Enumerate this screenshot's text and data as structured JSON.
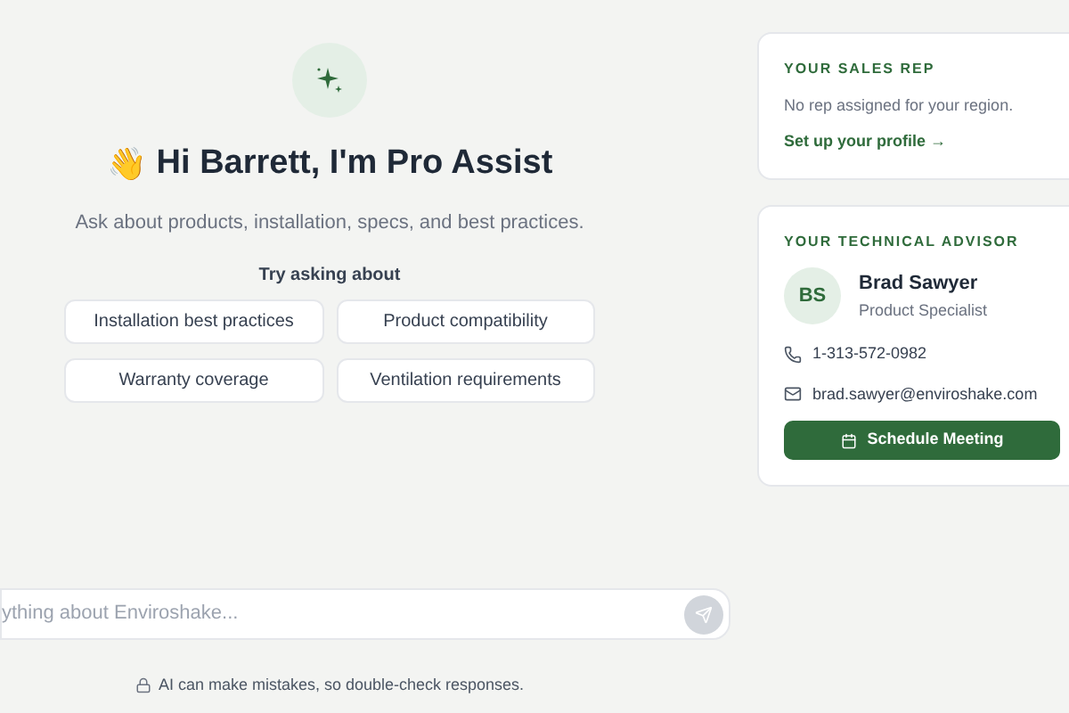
{
  "greeting": {
    "emoji": "👋",
    "title": "Hi Barrett, I'm Pro Assist",
    "subtitle": "Ask about products, installation, specs, and best practices."
  },
  "suggestions": {
    "heading": "Try asking about",
    "items": [
      "Installation best practices",
      "Product compatibility",
      "Warranty coverage",
      "Ventilation requirements"
    ]
  },
  "composer": {
    "placeholder": "ything about Enviroshake...",
    "disclaimer": "AI can make mistakes, so double-check responses."
  },
  "sales_rep": {
    "heading": "YOUR SALES REP",
    "message": "No rep assigned for your region.",
    "link": "Set up your profile →"
  },
  "advisor": {
    "heading": "YOUR TECHNICAL ADVISOR",
    "initials": "BS",
    "name": "Brad Sawyer",
    "role": "Product Specialist",
    "phone": "1-313-572-0982",
    "email": "brad.sawyer@enviroshake.com",
    "button": "Schedule Meeting"
  }
}
